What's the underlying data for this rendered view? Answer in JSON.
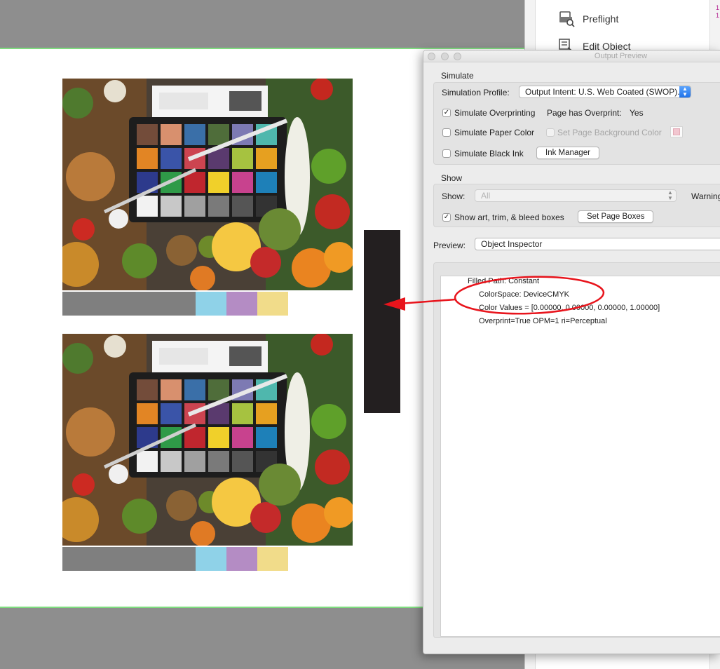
{
  "tools_pane": {
    "items": [
      {
        "label": "Preflight",
        "icon": "preflight-icon"
      },
      {
        "label": "Edit Object",
        "icon": "edit-object-icon"
      }
    ],
    "edge_marks": "1\n1"
  },
  "output_preview": {
    "title": "Output Preview",
    "simulate": {
      "group_label": "Simulate",
      "profile_label": "Simulation Profile:",
      "profile_value": "Output Intent: U.S. Web Coated (SWOP)...",
      "overprinting_label": "Simulate Overprinting",
      "overprinting_checked": true,
      "page_has_overprint_label": "Page has Overprint:",
      "page_has_overprint_value": "Yes",
      "paper_color_label": "Simulate Paper Color",
      "paper_color_checked": false,
      "bg_color_label": "Set Page Background Color",
      "bg_color_swatch": "#f2c6d0",
      "black_ink_label": "Simulate Black Ink",
      "black_ink_checked": false,
      "ink_manager_button": "Ink Manager"
    },
    "show": {
      "group_label": "Show",
      "show_label": "Show:",
      "show_value": "All",
      "warning_label": "Warning",
      "boxes_label": "Show art, trim, & bleed boxes",
      "boxes_checked": true,
      "set_page_boxes_button": "Set Page Boxes"
    },
    "preview": {
      "label": "Preview:",
      "value": "Object Inspector"
    },
    "inspector": {
      "lines": [
        "Filled Path: Constant",
        "ColorSpace: DeviceCMYK",
        "Color Values = [0.00000, 0.00000, 0.00000, 1.00000]",
        "Overprint=True OPM=1 ri=Perceptual"
      ]
    }
  },
  "page": {
    "strip_colors": [
      "#7f7f7f",
      "#7f7f7f",
      "#8fd2e8",
      "#b48cc4",
      "#f1dc8a"
    ],
    "black_bar_color": "#231f20",
    "annotation_color": "#e8141c"
  }
}
